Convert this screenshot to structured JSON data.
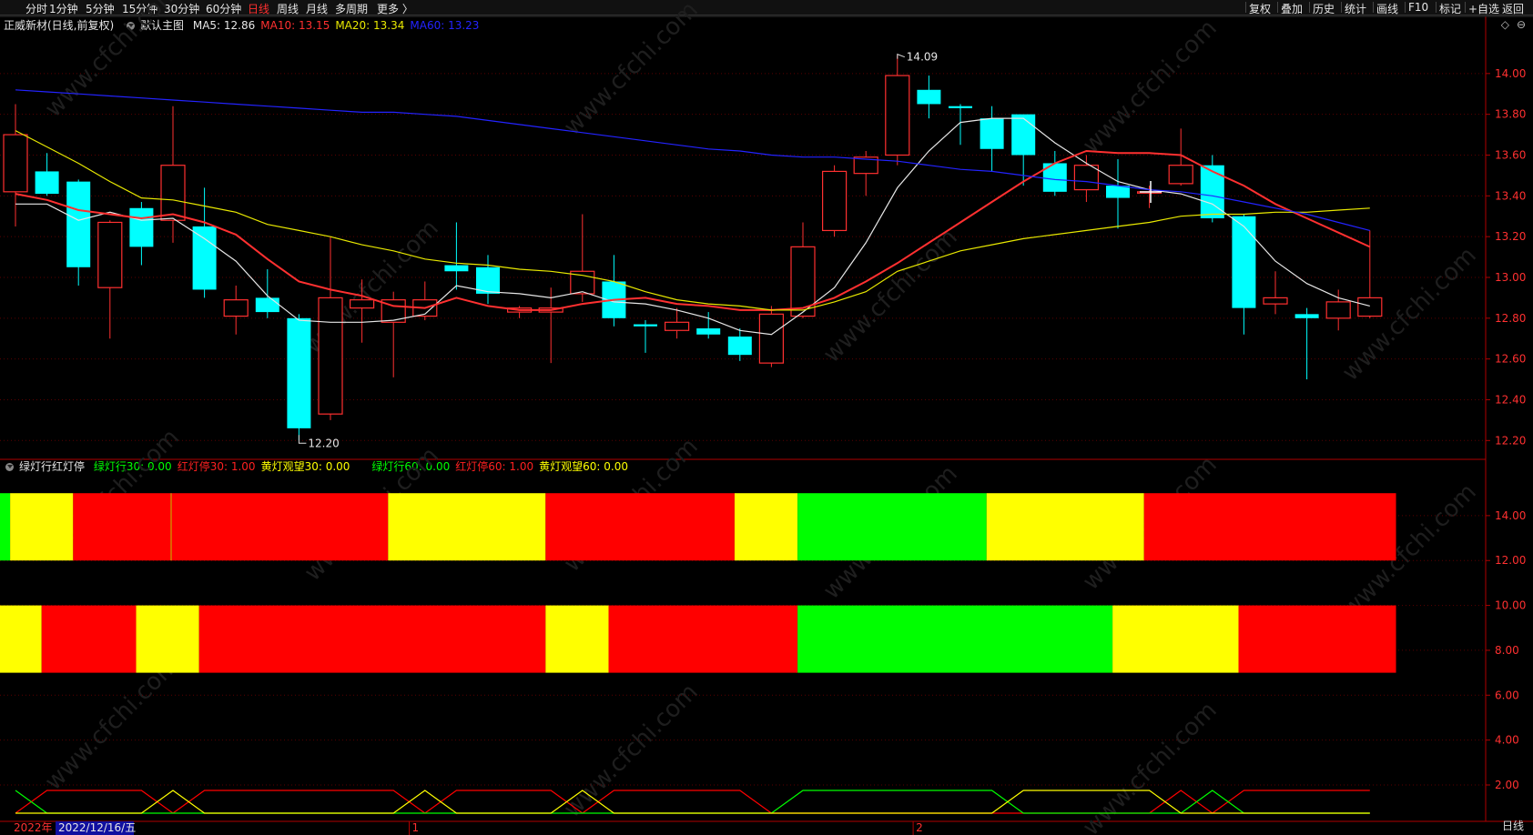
{
  "toolbar": {
    "periods": [
      "分时",
      "1分钟",
      "5分钟",
      "15分钟",
      "30分钟",
      "60分钟",
      "日线",
      "周线",
      "月线",
      "多周期",
      "更多 〉"
    ],
    "active_period": "日线",
    "right_buttons": [
      "复权",
      "叠加",
      "历史",
      "统计",
      "画线",
      "F10",
      "标记",
      "+自选",
      "返回"
    ]
  },
  "main_panel": {
    "stock": "正威新材(日线,前复权)",
    "template": "默认主图",
    "ma_labels": [
      {
        "text": "MA5: 12.86",
        "color": "#e6e6e6"
      },
      {
        "text": "MA10: 13.15",
        "color": "#ff3030"
      },
      {
        "text": "MA20: 13.34",
        "color": "#e8e800"
      },
      {
        "text": "MA60: 13.23",
        "color": "#2323ff"
      }
    ],
    "window_icons": [
      "◇",
      "⊖"
    ]
  },
  "indicator_panel": {
    "name": "绿灯行红灯停",
    "labels": [
      {
        "text": "绿灯行30: 0.00",
        "color": "#00ff00"
      },
      {
        "text": "红灯停30: 1.00",
        "color": "#ff2020"
      },
      {
        "text": "黄灯观望30: 0.00",
        "color": "#ffff00"
      },
      {
        "text": "绿灯行60: 0.00",
        "color": "#00ff00"
      },
      {
        "text": "红灯停60: 1.00",
        "color": "#ff2020"
      },
      {
        "text": "黄灯观望60: 0.00",
        "color": "#ffff00"
      }
    ]
  },
  "axis": {
    "year_label": "2022年",
    "cursor_date": "2022/12/16/五",
    "month_marks": [
      {
        "label": "1",
        "index": 12.5
      },
      {
        "label": "2",
        "index": 28.5
      }
    ],
    "period_label": "日线"
  },
  "watermark": "www.cfchi.com",
  "colors": {
    "up": "#ff3030",
    "down": "#00ffff",
    "green": "#00ff00",
    "red": "#ff0000",
    "yellow": "#ffff00",
    "grid": "#5a0000"
  },
  "chart_data": {
    "type": "candlestick",
    "y_ticks": [
      "14.00",
      "13.80",
      "13.60",
      "13.40",
      "13.20",
      "13.00",
      "12.80",
      "12.60",
      "12.40",
      "12.20"
    ],
    "ylim": [
      12.13,
      14.2
    ],
    "annotations": [
      {
        "text": "14.09",
        "index": 28,
        "value": 14.09
      },
      {
        "text": "12.20",
        "index": 9,
        "value": 12.2
      }
    ],
    "candles": [
      {
        "o": 13.42,
        "h": 13.85,
        "l": 13.25,
        "c": 13.7
      },
      {
        "o": 13.52,
        "h": 13.61,
        "l": 13.4,
        "c": 13.41
      },
      {
        "o": 13.47,
        "h": 13.48,
        "l": 12.96,
        "c": 13.05
      },
      {
        "o": 12.95,
        "h": 13.28,
        "l": 12.7,
        "c": 13.27
      },
      {
        "o": 13.34,
        "h": 13.37,
        "l": 13.06,
        "c": 13.15
      },
      {
        "o": 13.28,
        "h": 13.84,
        "l": 13.17,
        "c": 13.55
      },
      {
        "o": 13.25,
        "h": 13.44,
        "l": 12.9,
        "c": 12.94
      },
      {
        "o": 12.81,
        "h": 12.96,
        "l": 12.72,
        "c": 12.89
      },
      {
        "o": 12.9,
        "h": 13.04,
        "l": 12.8,
        "c": 12.83
      },
      {
        "o": 12.8,
        "h": 12.82,
        "l": 12.2,
        "c": 12.26
      },
      {
        "o": 12.33,
        "h": 13.2,
        "l": 12.3,
        "c": 12.9
      },
      {
        "o": 12.85,
        "h": 12.99,
        "l": 12.68,
        "c": 12.89
      },
      {
        "o": 12.78,
        "h": 12.93,
        "l": 12.51,
        "c": 12.89
      },
      {
        "o": 12.81,
        "h": 12.98,
        "l": 12.79,
        "c": 12.89
      },
      {
        "o": 13.06,
        "h": 13.27,
        "l": 12.94,
        "c": 13.03
      },
      {
        "o": 13.05,
        "h": 13.11,
        "l": 12.87,
        "c": 12.92
      },
      {
        "o": 12.83,
        "h": 12.86,
        "l": 12.8,
        "c": 12.85
      },
      {
        "o": 12.83,
        "h": 12.95,
        "l": 12.58,
        "c": 12.85
      },
      {
        "o": 12.92,
        "h": 13.31,
        "l": 12.88,
        "c": 13.03
      },
      {
        "o": 12.98,
        "h": 13.11,
        "l": 12.76,
        "c": 12.8
      },
      {
        "o": 12.77,
        "h": 12.79,
        "l": 12.63,
        "c": 12.76
      },
      {
        "o": 12.74,
        "h": 12.85,
        "l": 12.7,
        "c": 12.78
      },
      {
        "o": 12.75,
        "h": 12.83,
        "l": 12.7,
        "c": 12.72
      },
      {
        "o": 12.71,
        "h": 12.75,
        "l": 12.59,
        "c": 12.62
      },
      {
        "o": 12.58,
        "h": 12.86,
        "l": 12.56,
        "c": 12.82
      },
      {
        "o": 12.81,
        "h": 13.27,
        "l": 12.8,
        "c": 13.15
      },
      {
        "o": 13.23,
        "h": 13.55,
        "l": 13.2,
        "c": 13.52
      },
      {
        "o": 13.51,
        "h": 13.62,
        "l": 13.4,
        "c": 13.59
      },
      {
        "o": 13.6,
        "h": 14.09,
        "l": 13.55,
        "c": 13.99
      },
      {
        "o": 13.92,
        "h": 13.99,
        "l": 13.78,
        "c": 13.85
      },
      {
        "o": 13.84,
        "h": 13.85,
        "l": 13.65,
        "c": 13.83
      },
      {
        "o": 13.78,
        "h": 13.84,
        "l": 13.52,
        "c": 13.63
      },
      {
        "o": 13.8,
        "h": 13.78,
        "l": 13.45,
        "c": 13.6
      },
      {
        "o": 13.56,
        "h": 13.62,
        "l": 13.4,
        "c": 13.42
      },
      {
        "o": 13.43,
        "h": 13.6,
        "l": 13.37,
        "c": 13.55
      },
      {
        "o": 13.45,
        "h": 13.58,
        "l": 13.24,
        "c": 13.39
      },
      {
        "o": 13.42,
        "h": 13.45,
        "l": 13.34,
        "c": 13.42
      },
      {
        "o": 13.46,
        "h": 13.73,
        "l": 13.45,
        "c": 13.55
      },
      {
        "o": 13.55,
        "h": 13.6,
        "l": 13.27,
        "c": 13.29
      },
      {
        "o": 13.3,
        "h": 13.31,
        "l": 12.72,
        "c": 12.85
      },
      {
        "o": 12.87,
        "h": 13.03,
        "l": 12.82,
        "c": 12.9
      },
      {
        "o": 12.82,
        "h": 12.85,
        "l": 12.5,
        "c": 12.8
      },
      {
        "o": 12.8,
        "h": 12.94,
        "l": 12.74,
        "c": 12.88
      },
      {
        "o": 12.81,
        "h": 13.23,
        "l": 12.8,
        "c": 12.9
      }
    ],
    "series": [
      {
        "name": "MA5",
        "color": "#e6e6e6",
        "values": [
          13.36,
          13.36,
          13.28,
          13.32,
          13.28,
          13.29,
          13.19,
          13.08,
          12.91,
          12.79,
          12.78,
          12.78,
          12.79,
          12.82,
          12.96,
          12.93,
          12.92,
          12.9,
          12.93,
          12.88,
          12.87,
          12.84,
          12.8,
          12.74,
          12.72,
          12.83,
          12.95,
          13.17,
          13.44,
          13.62,
          13.76,
          13.78,
          13.78,
          13.66,
          13.56,
          13.47,
          13.43,
          13.41,
          13.36,
          13.25,
          13.08,
          12.97,
          12.9,
          12.86
        ]
      },
      {
        "name": "MA10",
        "color": "#ff3030",
        "values": [
          13.41,
          13.38,
          13.33,
          13.31,
          13.29,
          13.31,
          13.27,
          13.21,
          13.09,
          12.98,
          12.94,
          12.91,
          12.86,
          12.85,
          12.9,
          12.86,
          12.84,
          12.84,
          12.87,
          12.89,
          12.9,
          12.87,
          12.86,
          12.84,
          12.84,
          12.85,
          12.9,
          12.98,
          13.07,
          13.17,
          13.27,
          13.37,
          13.47,
          13.56,
          13.62,
          13.61,
          13.61,
          13.6,
          13.52,
          13.45,
          13.36,
          13.29,
          13.22,
          13.15
        ]
      },
      {
        "name": "MA20",
        "color": "#e8e800",
        "values": [
          13.72,
          13.64,
          13.56,
          13.47,
          13.39,
          13.38,
          13.35,
          13.32,
          13.26,
          13.23,
          13.2,
          13.16,
          13.13,
          13.09,
          13.07,
          13.06,
          13.04,
          13.03,
          13.01,
          12.98,
          12.93,
          12.89,
          12.87,
          12.86,
          12.84,
          12.84,
          12.88,
          12.93,
          13.03,
          13.08,
          13.13,
          13.16,
          13.19,
          13.21,
          13.23,
          13.25,
          13.27,
          13.3,
          13.31,
          13.31,
          13.32,
          13.32,
          13.33,
          13.34
        ]
      },
      {
        "name": "MA60",
        "color": "#2323ff",
        "values": [
          13.92,
          13.91,
          13.9,
          13.89,
          13.88,
          13.87,
          13.86,
          13.85,
          13.84,
          13.83,
          13.82,
          13.81,
          13.81,
          13.8,
          13.79,
          13.77,
          13.75,
          13.73,
          13.71,
          13.69,
          13.67,
          13.65,
          13.63,
          13.62,
          13.6,
          13.59,
          13.59,
          13.58,
          13.57,
          13.55,
          13.53,
          13.52,
          13.5,
          13.48,
          13.47,
          13.45,
          13.43,
          13.42,
          13.4,
          13.37,
          13.34,
          13.31,
          13.27,
          13.23
        ]
      }
    ],
    "indicator": {
      "y_ticks": [
        "14.00",
        "12.00",
        "10.00",
        "8.00",
        "6.00",
        "4.00",
        "2.00"
      ],
      "ylim": [
        0.5,
        15.9
      ],
      "band30": {
        "low": 12,
        "high": 15,
        "segments": [
          {
            "color": "#00ff00",
            "from": 0,
            "to": 0.33
          },
          {
            "color": "#ffff00",
            "from": 0.33,
            "to": 2.33
          },
          {
            "color": "#ff0000",
            "from": 2.33,
            "to": 12.33
          },
          {
            "color": "#ffff00",
            "from": 12.33,
            "to": 17.33
          },
          {
            "color": "#ff0000",
            "from": 17.33,
            "to": 23.33
          },
          {
            "color": "#ffff00",
            "from": 23.33,
            "to": 25.33
          },
          {
            "color": "#00ff00",
            "from": 25.33,
            "to": 31.33
          },
          {
            "color": "#ffff00",
            "from": 31.33,
            "to": 36.33
          },
          {
            "color": "#ff0000",
            "from": 36.33,
            "to": 44.33
          }
        ]
      },
      "band60": {
        "low": 7,
        "high": 10,
        "segments": [
          {
            "color": "#ffff00",
            "from": 0,
            "to": 1.33
          },
          {
            "color": "#ff0000",
            "from": 1.33,
            "to": 4.33
          },
          {
            "color": "#ffff00",
            "from": 4.33,
            "to": 6.33
          },
          {
            "color": "#ff0000",
            "from": 6.33,
            "to": 17.33
          },
          {
            "color": "#ffff00",
            "from": 17.33,
            "to": 19.33
          },
          {
            "color": "#ff0000",
            "from": 19.33,
            "to": 25.33
          },
          {
            "color": "#00ff00",
            "from": 25.33,
            "to": 35.33
          },
          {
            "color": "#ffff00",
            "from": 35.33,
            "to": 39.33
          },
          {
            "color": "#ff0000",
            "from": 39.33,
            "to": 44.33
          }
        ]
      },
      "signal_lines": [
        {
          "color": "#ff0000",
          "values": [
            0,
            1,
            1,
            1,
            1,
            0,
            1,
            1,
            1,
            1,
            1,
            1,
            1,
            0,
            1,
            1,
            1,
            1,
            0,
            1,
            1,
            1,
            1,
            1,
            0,
            0,
            0,
            0,
            0,
            0,
            0,
            0,
            0,
            0,
            0,
            0,
            0,
            1,
            0,
            1,
            1,
            1,
            1,
            1
          ]
        },
        {
          "color": "#00ff00",
          "values": [
            1,
            0,
            0,
            0,
            0,
            0,
            0,
            0,
            0,
            0,
            0,
            0,
            0,
            0,
            0,
            0,
            0,
            0,
            0,
            0,
            0,
            0,
            0,
            0,
            0,
            1,
            1,
            1,
            1,
            1,
            1,
            1,
            0,
            0,
            0,
            0,
            0,
            0,
            1,
            0,
            0,
            0,
            0,
            0
          ]
        },
        {
          "color": "#ffff00",
          "values": [
            0,
            0,
            0,
            0,
            0,
            1,
            0,
            0,
            0,
            0,
            0,
            0,
            0,
            1,
            0,
            0,
            0,
            0,
            1,
            0,
            0,
            0,
            0,
            0,
            0,
            0,
            0,
            0,
            0,
            0,
            0,
            0,
            1,
            1,
            1,
            1,
            1,
            0,
            0,
            0,
            0,
            0,
            0,
            0
          ]
        }
      ]
    }
  }
}
